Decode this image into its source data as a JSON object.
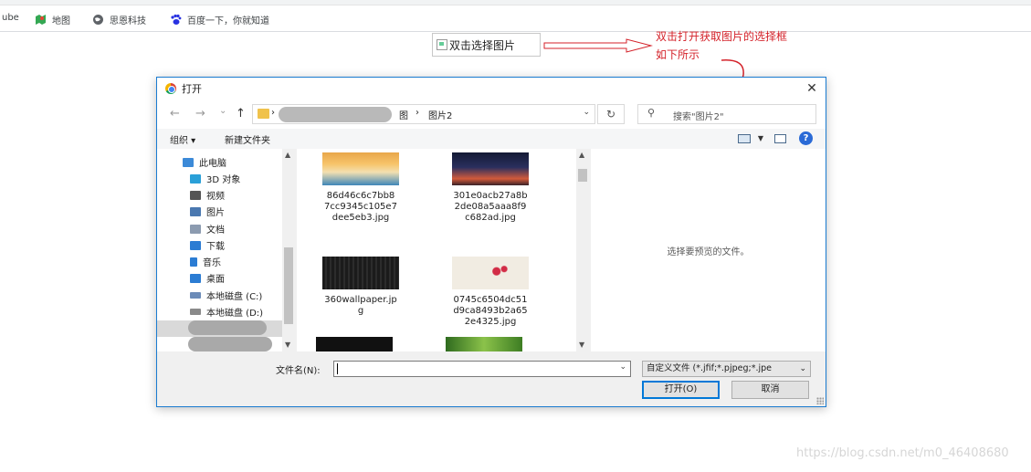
{
  "bookmarks": [
    {
      "label": "ube",
      "icon": "youtube-icon"
    },
    {
      "label": "地图",
      "icon": "maps-icon"
    },
    {
      "label": "思恩科技",
      "icon": "globe-icon"
    },
    {
      "label": "百度一下，你就知道",
      "icon": "baidu-paw-icon"
    }
  ],
  "page": {
    "broken_image_alt": "双击选择图片",
    "annotation_line1": "双击打开获取图片的选择框",
    "annotation_line2": "如下所示",
    "watermark": "https://blog.csdn.net/m0_46408680"
  },
  "dialog": {
    "title": "打开",
    "close": "✕",
    "nav": {
      "back": "←",
      "forward": "→",
      "recent": "⌄",
      "up": "↑",
      "refresh": "↻"
    },
    "address": {
      "sep1": "›",
      "crumb1": "图",
      "sep2": "›",
      "crumb2": "图片2"
    },
    "search_placeholder": "搜索\"图片2\"",
    "toolbar": {
      "organize": "组织 ▾",
      "new_folder": "新建文件夹"
    },
    "tree": [
      {
        "label": "此电脑",
        "icon": "computer-icon",
        "color": "#3c8ad8"
      },
      {
        "label": "3D 对象",
        "icon": "cube-icon",
        "color": "#2aa0d8"
      },
      {
        "label": "视频",
        "icon": "video-icon",
        "color": "#555555"
      },
      {
        "label": "图片",
        "icon": "pictures-icon",
        "color": "#4a78b0"
      },
      {
        "label": "文档",
        "icon": "documents-icon",
        "color": "#8c9bb0"
      },
      {
        "label": "下载",
        "icon": "download-icon",
        "color": "#2b7cd3"
      },
      {
        "label": "音乐",
        "icon": "music-icon",
        "color": "#2b7cd3"
      },
      {
        "label": "桌面",
        "icon": "desktop-icon",
        "color": "#2b7cd3"
      },
      {
        "label": "本地磁盘 (C:)",
        "icon": "drive-c-icon",
        "color": "#6b8bb8"
      },
      {
        "label": "本地磁盘 (D:)",
        "icon": "drive-d-icon",
        "color": "#8a8a8a"
      }
    ],
    "files": [
      {
        "name": "86d46c6c7bb8\n7cc9345c105e7\ndee5eb3.jpg",
        "thumb": "beach"
      },
      {
        "name": "301e0acb27a8b\n2de08a5aaa8f9\nc682ad.jpg",
        "thumb": "city"
      },
      {
        "name": "360wallpaper.jp\ng",
        "thumb": "dark"
      },
      {
        "name": "0745c6504dc51\nd9ca8493b2a65\n2e4325.jpg",
        "thumb": "flowers"
      }
    ],
    "preview_text": "选择要预览的文件。",
    "filename_label": "文件名(N):",
    "filename_value": "",
    "filter_value": "自定义文件 (*.jfif;*.pjpeg;*.jpe",
    "open_button": "打开(O)",
    "cancel_button": "取消"
  }
}
